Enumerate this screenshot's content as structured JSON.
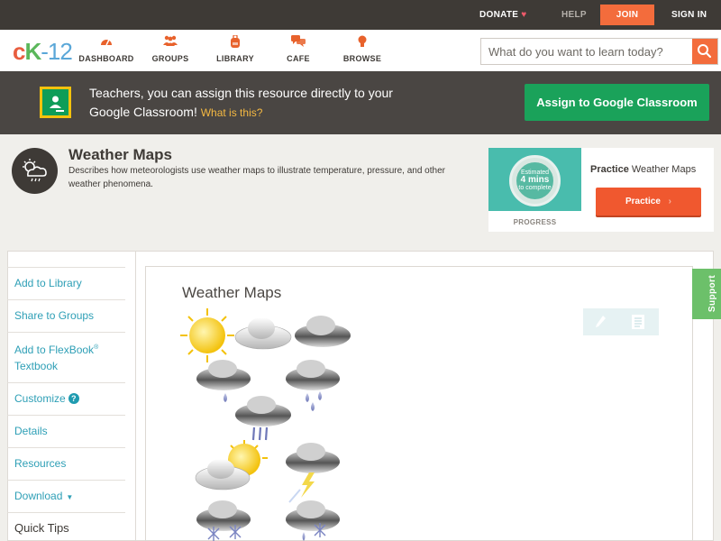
{
  "topbar": {
    "donate": "DONATE",
    "help": "HELP",
    "join": "JOIN",
    "signin": "SIGN IN"
  },
  "header": {
    "logo": {
      "c": "c",
      "k": "K",
      "n": "-12"
    },
    "nav": [
      {
        "label": "DASHBOARD",
        "icon": "dashboard-gauge-icon"
      },
      {
        "label": "GROUPS",
        "icon": "groups-people-icon"
      },
      {
        "label": "LIBRARY",
        "icon": "library-backpack-icon"
      },
      {
        "label": "CAFE",
        "icon": "cafe-chat-icon"
      },
      {
        "label": "BROWSE",
        "icon": "browse-lightbulb-icon"
      }
    ],
    "search_placeholder": "What do you want to learn today?"
  },
  "banner": {
    "message": "Teachers, you can assign this resource directly to your Google Classroom!",
    "link": "What is this?",
    "button": "Assign to Google Classroom"
  },
  "concept": {
    "title": "Weather Maps",
    "description": "Describes how meteorologists use weather maps to illustrate temperature, pressure, and other weather phenomena."
  },
  "practice": {
    "thumb_line1": "Estimated",
    "thumb_line2": "4 mins",
    "thumb_line3": "to complete",
    "progress": "PROGRESS",
    "title_bold": "Practice",
    "title_rest": "Weather Maps",
    "button": "Practice"
  },
  "sidebar": {
    "items": [
      "Add to Library",
      "Share to Groups",
      "Add to FlexBook",
      "Customize",
      "Details",
      "Resources",
      "Download",
      "Quick Tips"
    ],
    "flexbook_sup": "®",
    "flexbook_line2": "Textbook"
  },
  "content": {
    "title": "Weather Maps"
  },
  "support": "Support",
  "colors": {
    "accent_orange": "#f36c3c",
    "banner_green": "#1aa25a",
    "link_teal": "#2e9fb6",
    "support_green": "#6cc06a"
  }
}
